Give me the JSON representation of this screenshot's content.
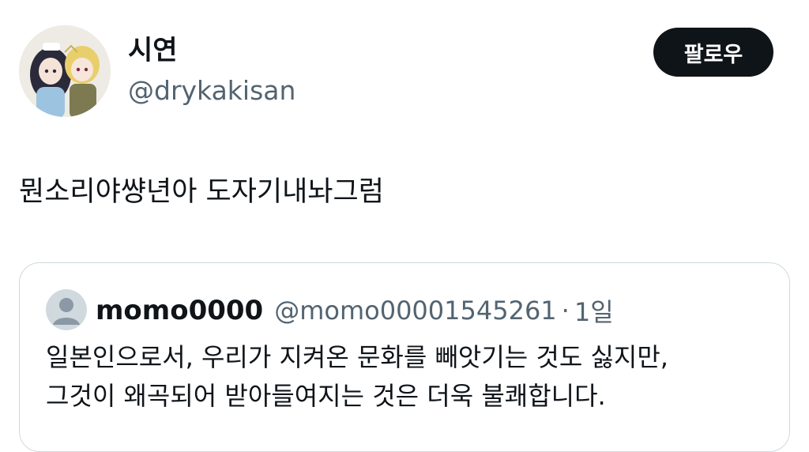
{
  "post": {
    "author": {
      "display_name": "시연",
      "handle": "@drykakisan",
      "avatar_icon": "profile-avatar-illustration"
    },
    "follow_label": "팔로우",
    "text": "뭔소리야썅년아 도자기내놔그럼"
  },
  "quote": {
    "author": {
      "display_name": "momo0000",
      "handle": "@momo00001545261",
      "avatar_icon": "default-user-avatar-icon"
    },
    "separator": "·",
    "time": "1일",
    "lines": [
      "일본인으로서, 우리가 지켜온 문화를 빼앗기는 것도 싫지만,",
      "그것이 왜곡되어 받아들여지는 것은 더욱 불쾌합니다."
    ]
  },
  "colors": {
    "text_primary": "#0f1419",
    "text_secondary": "#536471",
    "border": "#cfd9de",
    "button_bg": "#0f1419",
    "button_text": "#ffffff"
  }
}
